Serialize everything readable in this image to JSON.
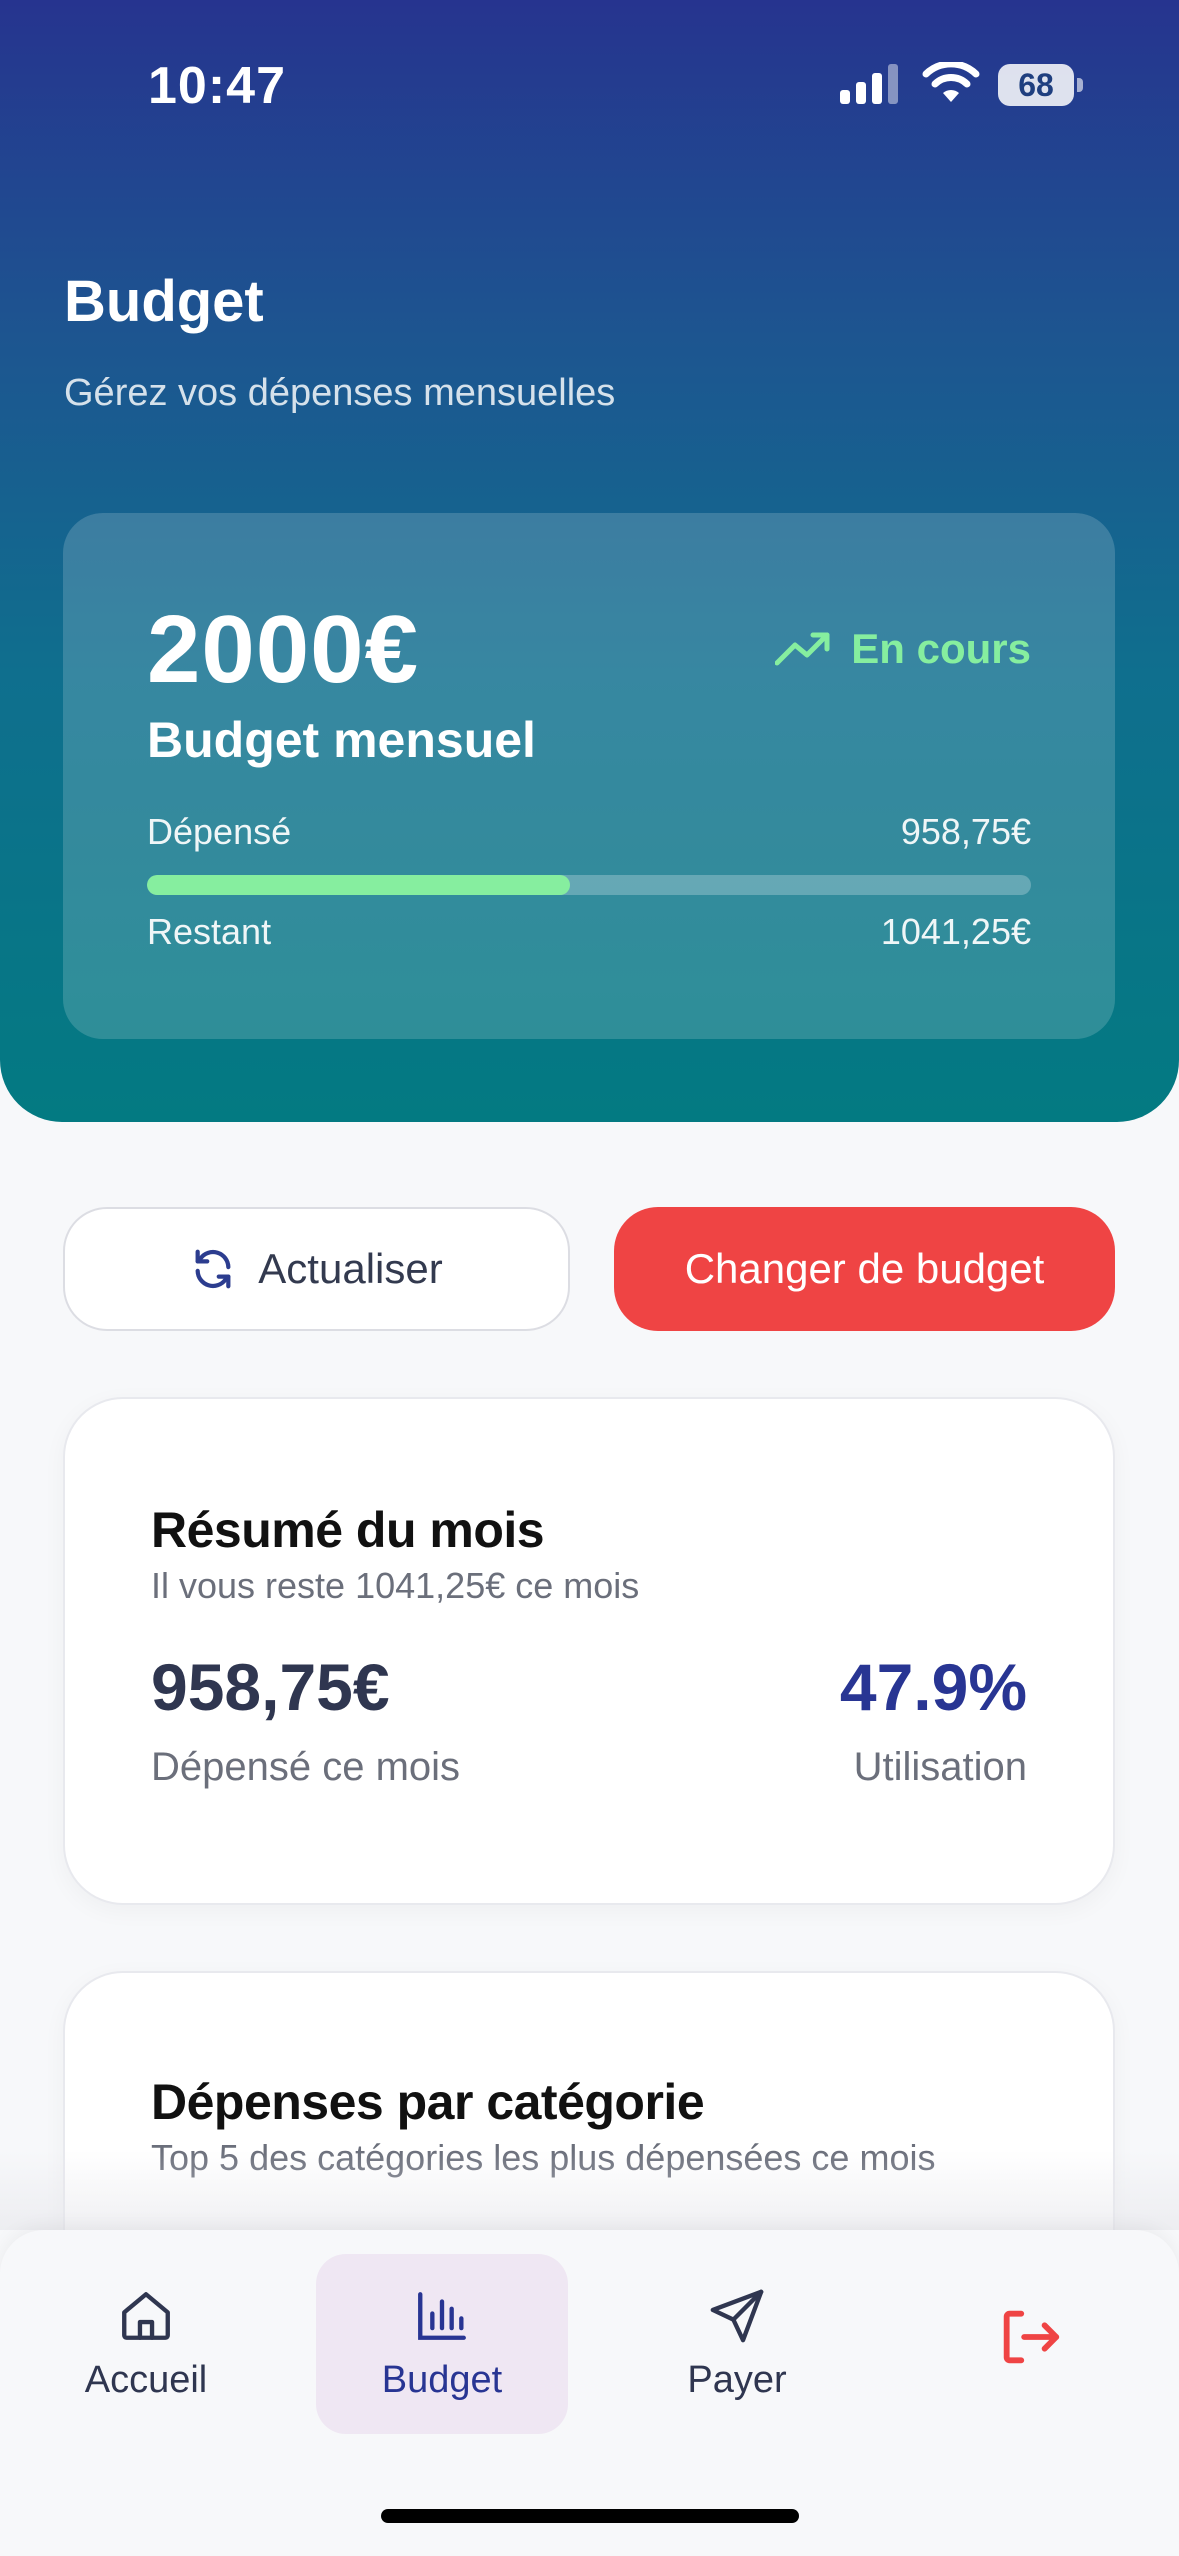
{
  "status_bar": {
    "time": "10:47",
    "battery": "68"
  },
  "header": {
    "title": "Budget",
    "subtitle": "Gérez vos dépenses mensuelles"
  },
  "budget_card": {
    "amount": "2000€",
    "label": "Budget mensuel",
    "status": "En cours",
    "spent_label": "Dépensé",
    "spent_value": "958,75€",
    "remaining_label": "Restant",
    "remaining_value": "1041,25€",
    "progress_fraction": 0.479
  },
  "actions": {
    "refresh_label": "Actualiser",
    "change_label": "Changer de budget"
  },
  "summary": {
    "title": "Résumé du mois",
    "subtitle": "Il vous reste 1041,25€ ce mois",
    "spent_value": "958,75€",
    "spent_label": "Dépensé ce mois",
    "usage_value": "47.9%",
    "usage_label": "Utilisation"
  },
  "categories": {
    "title": "Dépenses par catégorie",
    "subtitle": "Top 5 des catégories les plus dépensées ce mois"
  },
  "tabbar": {
    "items": [
      {
        "label": "Accueil",
        "icon": "home-icon"
      },
      {
        "label": "Budget",
        "icon": "bar-chart-icon",
        "active": true
      },
      {
        "label": "Payer",
        "icon": "send-icon"
      },
      {
        "label": "",
        "icon": "logout-icon"
      }
    ]
  },
  "colors": {
    "accent": "#283593",
    "success": "#86ee9f",
    "danger": "#ef4444"
  }
}
